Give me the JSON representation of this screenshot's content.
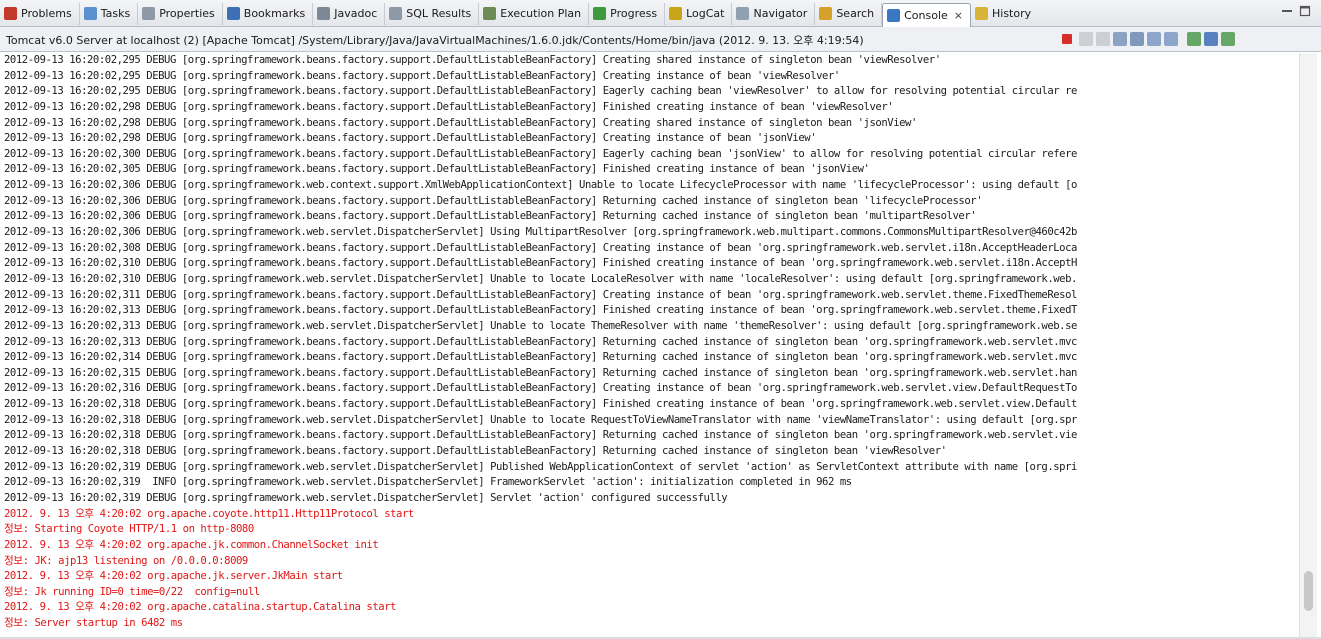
{
  "tabs": [
    {
      "label": "Problems",
      "icon": "problems-icon",
      "color": "#c0392b"
    },
    {
      "label": "Tasks",
      "icon": "tasks-icon",
      "color": "#5a8fd0"
    },
    {
      "label": "Properties",
      "icon": "properties-icon",
      "color": "#8d99a6"
    },
    {
      "label": "Bookmarks",
      "icon": "bookmarks-icon",
      "color": "#3d6fb5"
    },
    {
      "label": "Javadoc",
      "icon": "javadoc-icon",
      "color": "#7d8894"
    },
    {
      "label": "SQL Results",
      "icon": "sql-results-icon",
      "color": "#8d99a6"
    },
    {
      "label": "Execution Plan",
      "icon": "execution-plan-icon",
      "color": "#6e8a55"
    },
    {
      "label": "Progress",
      "icon": "progress-icon",
      "color": "#3f9a3f"
    },
    {
      "label": "LogCat",
      "icon": "logcat-icon",
      "color": "#c9a416"
    },
    {
      "label": "Navigator",
      "icon": "navigator-icon",
      "color": "#8fa0b0"
    },
    {
      "label": "Search",
      "icon": "search-icon",
      "color": "#d6a12a"
    },
    {
      "label": "Console",
      "icon": "console-icon",
      "color": "#3a78c4",
      "active": true,
      "close": "⨯"
    },
    {
      "label": "History",
      "icon": "history-icon",
      "color": "#d8b33a"
    }
  ],
  "window_controls": {
    "minimize": "minimize-icon",
    "maximize": "maximize-icon"
  },
  "console": {
    "title": "Tomcat v6.0 Server at localhost (2) [Apache Tomcat] /System/Library/Java/JavaVirtualMachines/1.6.0.jdk/Contents/Home/bin/java (2012. 9. 13. 오후 4:19:54)",
    "toolbar_icons": [
      {
        "name": "terminate-icon",
        "color": "#d62c2c"
      },
      {
        "name": "remove-launch-icon",
        "color": "#c5c9ce"
      },
      {
        "name": "remove-all-terminated-icon",
        "color": "#c5c9ce"
      },
      {
        "name": "clear-console-icon",
        "color": "#7a94b8"
      },
      {
        "name": "scroll-lock-icon",
        "color": "#6b89b3"
      },
      {
        "name": "word-wrap-icon",
        "color": "#7b98c2"
      },
      {
        "name": "show-console-on-output-icon",
        "color": "#7b98c2"
      },
      {
        "name": "pin-console-icon",
        "color": "#4e9a4e"
      },
      {
        "name": "display-selected-console-icon",
        "color": "#3c6fb5"
      },
      {
        "name": "open-console-icon",
        "color": "#4e9a4e"
      }
    ],
    "lines": [
      {
        "text": "2012-09-13 16:20:02,295 DEBUG [org.springframework.beans.factory.support.DefaultListableBeanFactory] Creating shared instance of singleton bean 'viewResolver'",
        "color": "black"
      },
      {
        "text": "2012-09-13 16:20:02,295 DEBUG [org.springframework.beans.factory.support.DefaultListableBeanFactory] Creating instance of bean 'viewResolver'",
        "color": "black"
      },
      {
        "text": "2012-09-13 16:20:02,295 DEBUG [org.springframework.beans.factory.support.DefaultListableBeanFactory] Eagerly caching bean 'viewResolver' to allow for resolving potential circular re",
        "color": "black"
      },
      {
        "text": "2012-09-13 16:20:02,298 DEBUG [org.springframework.beans.factory.support.DefaultListableBeanFactory] Finished creating instance of bean 'viewResolver'",
        "color": "black"
      },
      {
        "text": "2012-09-13 16:20:02,298 DEBUG [org.springframework.beans.factory.support.DefaultListableBeanFactory] Creating shared instance of singleton bean 'jsonView'",
        "color": "black"
      },
      {
        "text": "2012-09-13 16:20:02,298 DEBUG [org.springframework.beans.factory.support.DefaultListableBeanFactory] Creating instance of bean 'jsonView'",
        "color": "black"
      },
      {
        "text": "2012-09-13 16:20:02,300 DEBUG [org.springframework.beans.factory.support.DefaultListableBeanFactory] Eagerly caching bean 'jsonView' to allow for resolving potential circular refere",
        "color": "black"
      },
      {
        "text": "2012-09-13 16:20:02,305 DEBUG [org.springframework.beans.factory.support.DefaultListableBeanFactory] Finished creating instance of bean 'jsonView'",
        "color": "black"
      },
      {
        "text": "2012-09-13 16:20:02,306 DEBUG [org.springframework.web.context.support.XmlWebApplicationContext] Unable to locate LifecycleProcessor with name 'lifecycleProcessor': using default [o",
        "color": "black"
      },
      {
        "text": "2012-09-13 16:20:02,306 DEBUG [org.springframework.beans.factory.support.DefaultListableBeanFactory] Returning cached instance of singleton bean 'lifecycleProcessor'",
        "color": "black"
      },
      {
        "text": "2012-09-13 16:20:02,306 DEBUG [org.springframework.beans.factory.support.DefaultListableBeanFactory] Returning cached instance of singleton bean 'multipartResolver'",
        "color": "black"
      },
      {
        "text": "2012-09-13 16:20:02,306 DEBUG [org.springframework.web.servlet.DispatcherServlet] Using MultipartResolver [org.springframework.web.multipart.commons.CommonsMultipartResolver@460c42b",
        "color": "black"
      },
      {
        "text": "2012-09-13 16:20:02,308 DEBUG [org.springframework.beans.factory.support.DefaultListableBeanFactory] Creating instance of bean 'org.springframework.web.servlet.i18n.AcceptHeaderLoca",
        "color": "black"
      },
      {
        "text": "2012-09-13 16:20:02,310 DEBUG [org.springframework.beans.factory.support.DefaultListableBeanFactory] Finished creating instance of bean 'org.springframework.web.servlet.i18n.AcceptH",
        "color": "black"
      },
      {
        "text": "2012-09-13 16:20:02,310 DEBUG [org.springframework.web.servlet.DispatcherServlet] Unable to locate LocaleResolver with name 'localeResolver': using default [org.springframework.web.",
        "color": "black"
      },
      {
        "text": "2012-09-13 16:20:02,311 DEBUG [org.springframework.beans.factory.support.DefaultListableBeanFactory] Creating instance of bean 'org.springframework.web.servlet.theme.FixedThemeResol",
        "color": "black"
      },
      {
        "text": "2012-09-13 16:20:02,313 DEBUG [org.springframework.beans.factory.support.DefaultListableBeanFactory] Finished creating instance of bean 'org.springframework.web.servlet.theme.FixedT",
        "color": "black"
      },
      {
        "text": "2012-09-13 16:20:02,313 DEBUG [org.springframework.web.servlet.DispatcherServlet] Unable to locate ThemeResolver with name 'themeResolver': using default [org.springframework.web.se",
        "color": "black"
      },
      {
        "text": "2012-09-13 16:20:02,313 DEBUG [org.springframework.beans.factory.support.DefaultListableBeanFactory] Returning cached instance of singleton bean 'org.springframework.web.servlet.mvc",
        "color": "black"
      },
      {
        "text": "2012-09-13 16:20:02,314 DEBUG [org.springframework.beans.factory.support.DefaultListableBeanFactory] Returning cached instance of singleton bean 'org.springframework.web.servlet.mvc",
        "color": "black"
      },
      {
        "text": "2012-09-13 16:20:02,315 DEBUG [org.springframework.beans.factory.support.DefaultListableBeanFactory] Returning cached instance of singleton bean 'org.springframework.web.servlet.han",
        "color": "black"
      },
      {
        "text": "2012-09-13 16:20:02,316 DEBUG [org.springframework.beans.factory.support.DefaultListableBeanFactory] Creating instance of bean 'org.springframework.web.servlet.view.DefaultRequestTo",
        "color": "black"
      },
      {
        "text": "2012-09-13 16:20:02,318 DEBUG [org.springframework.beans.factory.support.DefaultListableBeanFactory] Finished creating instance of bean 'org.springframework.web.servlet.view.Default",
        "color": "black"
      },
      {
        "text": "2012-09-13 16:20:02,318 DEBUG [org.springframework.web.servlet.DispatcherServlet] Unable to locate RequestToViewNameTranslator with name 'viewNameTranslator': using default [org.spr",
        "color": "black"
      },
      {
        "text": "2012-09-13 16:20:02,318 DEBUG [org.springframework.beans.factory.support.DefaultListableBeanFactory] Returning cached instance of singleton bean 'org.springframework.web.servlet.vie",
        "color": "black"
      },
      {
        "text": "2012-09-13 16:20:02,318 DEBUG [org.springframework.beans.factory.support.DefaultListableBeanFactory] Returning cached instance of singleton bean 'viewResolver'",
        "color": "black"
      },
      {
        "text": "2012-09-13 16:20:02,319 DEBUG [org.springframework.web.servlet.DispatcherServlet] Published WebApplicationContext of servlet 'action' as ServletContext attribute with name [org.spri",
        "color": "black"
      },
      {
        "text": "2012-09-13 16:20:02,319  INFO [org.springframework.web.servlet.DispatcherServlet] FrameworkServlet 'action': initialization completed in 962 ms",
        "color": "black"
      },
      {
        "text": "2012-09-13 16:20:02,319 DEBUG [org.springframework.web.servlet.DispatcherServlet] Servlet 'action' configured successfully",
        "color": "black"
      },
      {
        "text": "2012. 9. 13 오후 4:20:02 org.apache.coyote.http11.Http11Protocol start",
        "color": "red"
      },
      {
        "text": "정보: Starting Coyote HTTP/1.1 on http-8080",
        "color": "red"
      },
      {
        "text": "2012. 9. 13 오후 4:20:02 org.apache.jk.common.ChannelSocket init",
        "color": "red"
      },
      {
        "text": "정보: JK: ajp13 listening on /0.0.0.0:8009",
        "color": "red"
      },
      {
        "text": "2012. 9. 13 오후 4:20:02 org.apache.jk.server.JkMain start",
        "color": "red"
      },
      {
        "text": "정보: Jk running ID=0 time=0/22  config=null",
        "color": "red"
      },
      {
        "text": "2012. 9. 13 오후 4:20:02 org.apache.catalina.startup.Catalina start",
        "color": "red"
      },
      {
        "text": "정보: Server startup in 6482 ms",
        "color": "red"
      }
    ]
  },
  "scrollbar": {
    "position_fraction": 0.95
  }
}
